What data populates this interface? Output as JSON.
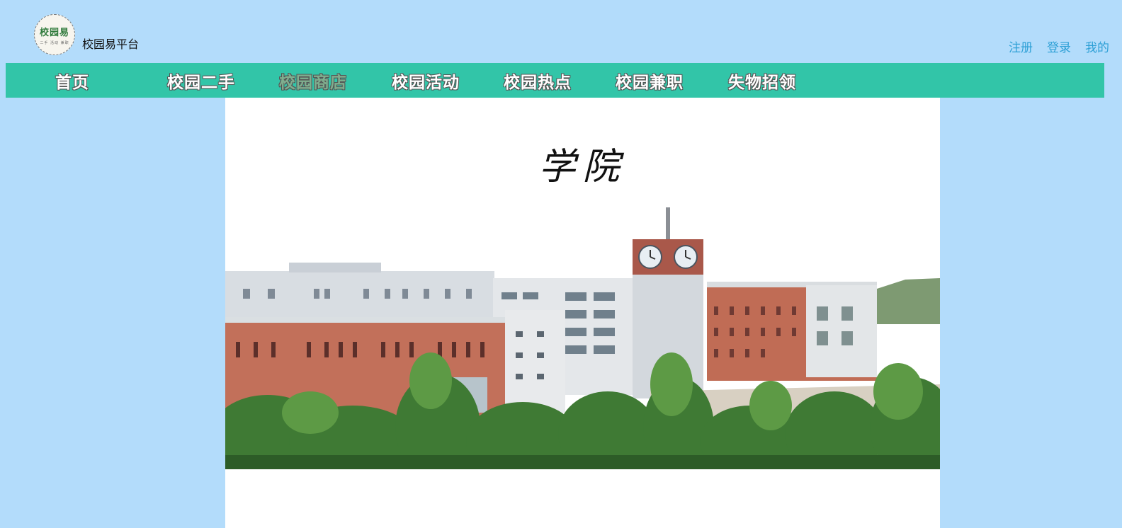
{
  "header": {
    "logo": {
      "text": "校园易",
      "sub": "二手 活动 兼职"
    },
    "site_name": "校园易平台",
    "links": [
      "注册",
      "登录",
      "我的"
    ]
  },
  "nav": {
    "items": [
      "首页",
      "校园二手",
      "校园商店",
      "校园活动",
      "校园热点",
      "校园兼职",
      "失物招领"
    ],
    "active_index": 2
  },
  "main": {
    "title": "学院",
    "photo_icon": "campus-building-photo"
  },
  "colors": {
    "page_bg": "#b3dcfb",
    "nav_bg": "#32c5a8",
    "link": "#2ea0d6",
    "content_bg": "#ffffff"
  }
}
